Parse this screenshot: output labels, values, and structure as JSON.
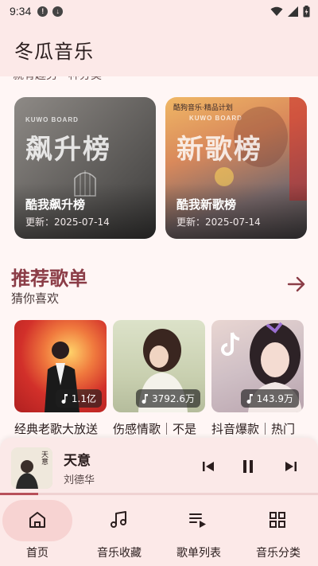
{
  "status_bar": {
    "time": "9:34"
  },
  "app_bar": {
    "title": "冬瓜音乐"
  },
  "cut_off_text": "就有趣另一种分类",
  "boards": [
    {
      "tag": "KUWO BOARD",
      "big_text": "飙升榜",
      "name": "酷我飙升榜",
      "updated": "更新：2025-07-14"
    },
    {
      "tag": "KUWO BOARD",
      "top_text": "酷狗音乐·精品计划",
      "big_text": "新歌榜",
      "name": "酷我新歌榜",
      "updated": "更新：2025-07-14"
    }
  ],
  "section": {
    "title": "推荐歌单",
    "subtitle": "猜你喜欢"
  },
  "playlists": [
    {
      "name": "经典老歌大放送",
      "count": "1.1亿"
    },
    {
      "name": "伤感情歌｜不是",
      "count": "3792.6万"
    },
    {
      "name": "抖音爆款｜热门",
      "count": "143.9万"
    }
  ],
  "player": {
    "title": "天意",
    "artist": "刘德华",
    "cover_text": "天意",
    "progress": 0.12
  },
  "nav": [
    {
      "label": "首页",
      "icon": "home-icon",
      "active": true
    },
    {
      "label": "音乐收藏",
      "icon": "music-note-icon",
      "active": false
    },
    {
      "label": "歌单列表",
      "icon": "playlist-icon",
      "active": false
    },
    {
      "label": "音乐分类",
      "icon": "grid-icon",
      "active": false
    }
  ],
  "colors": {
    "accent": "#8b3d47",
    "background": "#fff6f5",
    "bar": "#fce9e8",
    "active_pill": "#f7d3d2"
  }
}
